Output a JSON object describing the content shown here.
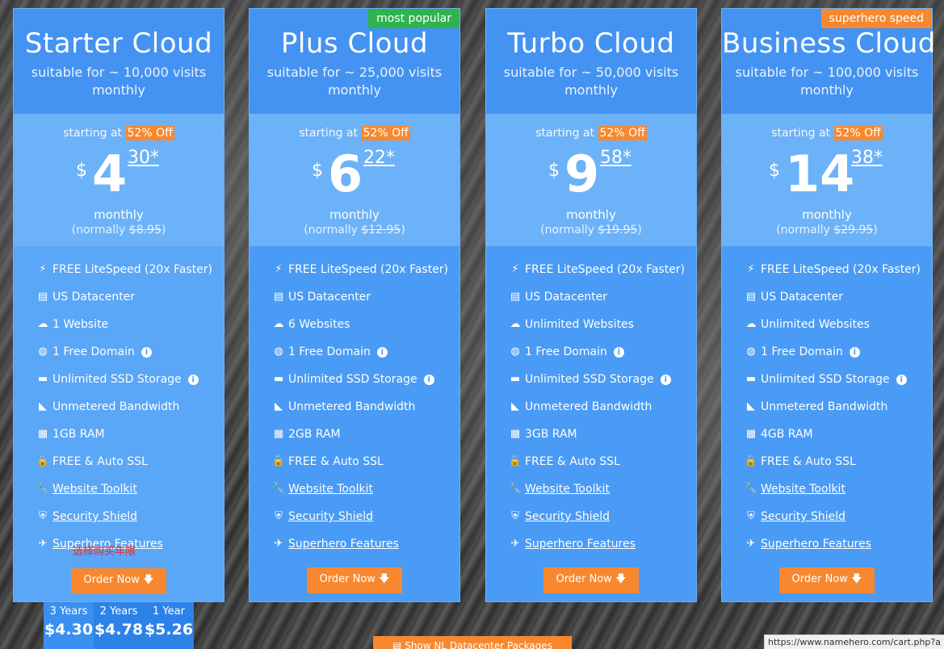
{
  "plans": [
    {
      "name": "Starter Cloud",
      "sub": "suitable for ~ 10,000 visits monthly",
      "starting": "starting at",
      "off": "52% Off",
      "currency": "$",
      "dollars": "4",
      "cents": "30*",
      "period": "monthly",
      "normally_prefix": "(normally ",
      "normally_price": "$8.95",
      "normally_suffix": ")",
      "badge": "",
      "order_label": "Order Now",
      "features": [
        "FREE LiteSpeed (20x Faster)",
        "US Datacenter",
        "1 Website",
        "1 Free Domain",
        "Unlimited SSD Storage",
        "Unmetered Bandwidth",
        "1GB RAM",
        "FREE & Auto SSL",
        "Website Toolkit",
        "Security Shield",
        "Superhero Features"
      ]
    },
    {
      "name": "Plus Cloud",
      "sub": "suitable for ~ 25,000 visits monthly",
      "starting": "starting at",
      "off": "52% Off",
      "currency": "$",
      "dollars": "6",
      "cents": "22*",
      "period": "monthly",
      "normally_prefix": "(normally ",
      "normally_price": "$12.95",
      "normally_suffix": ")",
      "badge": "most popular",
      "order_label": "Order Now",
      "features": [
        "FREE LiteSpeed (20x Faster)",
        "US Datacenter",
        "6 Websites",
        "1 Free Domain",
        "Unlimited SSD Storage",
        "Unmetered Bandwidth",
        "2GB RAM",
        "FREE & Auto SSL",
        "Website Toolkit",
        "Security Shield",
        "Superhero Features"
      ]
    },
    {
      "name": "Turbo Cloud",
      "sub": "suitable for ~ 50,000 visits monthly",
      "starting": "starting at",
      "off": "52% Off",
      "currency": "$",
      "dollars": "9",
      "cents": "58*",
      "period": "monthly",
      "normally_prefix": "(normally ",
      "normally_price": "$19.95",
      "normally_suffix": ")",
      "badge": "",
      "order_label": "Order Now",
      "features": [
        "FREE LiteSpeed (20x Faster)",
        "US Datacenter",
        "Unlimited Websites",
        "1 Free Domain",
        "Unlimited SSD Storage",
        "Unmetered Bandwidth",
        "3GB RAM",
        "FREE & Auto SSL",
        "Website Toolkit",
        "Security Shield",
        "Superhero Features"
      ]
    },
    {
      "name": "Business Cloud",
      "sub": "suitable for ~ 100,000 visits monthly",
      "starting": "starting at",
      "off": "52% Off",
      "currency": "$",
      "dollars": "14",
      "cents": "38*",
      "period": "monthly",
      "normally_prefix": "(normally ",
      "normally_price": "$29.95",
      "normally_suffix": ")",
      "badge": "superhero speed",
      "order_label": "Order Now",
      "features": [
        "FREE LiteSpeed (20x Faster)",
        "US Datacenter",
        "Unlimited Websites",
        "1 Free Domain",
        "Unlimited SSD Storage",
        "Unmetered Bandwidth",
        "4GB RAM",
        "FREE & Auto SSL",
        "Website Toolkit",
        "Security Shield",
        "Superhero Features"
      ]
    }
  ],
  "feature_icons": [
    "bolt-icon",
    "server-icon",
    "cloud-icon",
    "globe-icon",
    "hdd-icon",
    "chart-icon",
    "chip-icon",
    "lock-icon",
    "wrench-icon",
    "shield-icon",
    "plane-icon"
  ],
  "cn_note": "选择购买年限",
  "years": [
    {
      "label": "3 Years",
      "price": "$4.30"
    },
    {
      "label": "2 Years",
      "price": "$4.78"
    },
    {
      "label": "1 Year",
      "price": "$5.26"
    }
  ],
  "nl_button": "Show NL Datacenter Packages",
  "status_url": "https://www.namehero.com/cart.php?a",
  "colors": {
    "card": "#4a9bf5",
    "accent": "#f7882f",
    "popular": "#2fb34f"
  }
}
